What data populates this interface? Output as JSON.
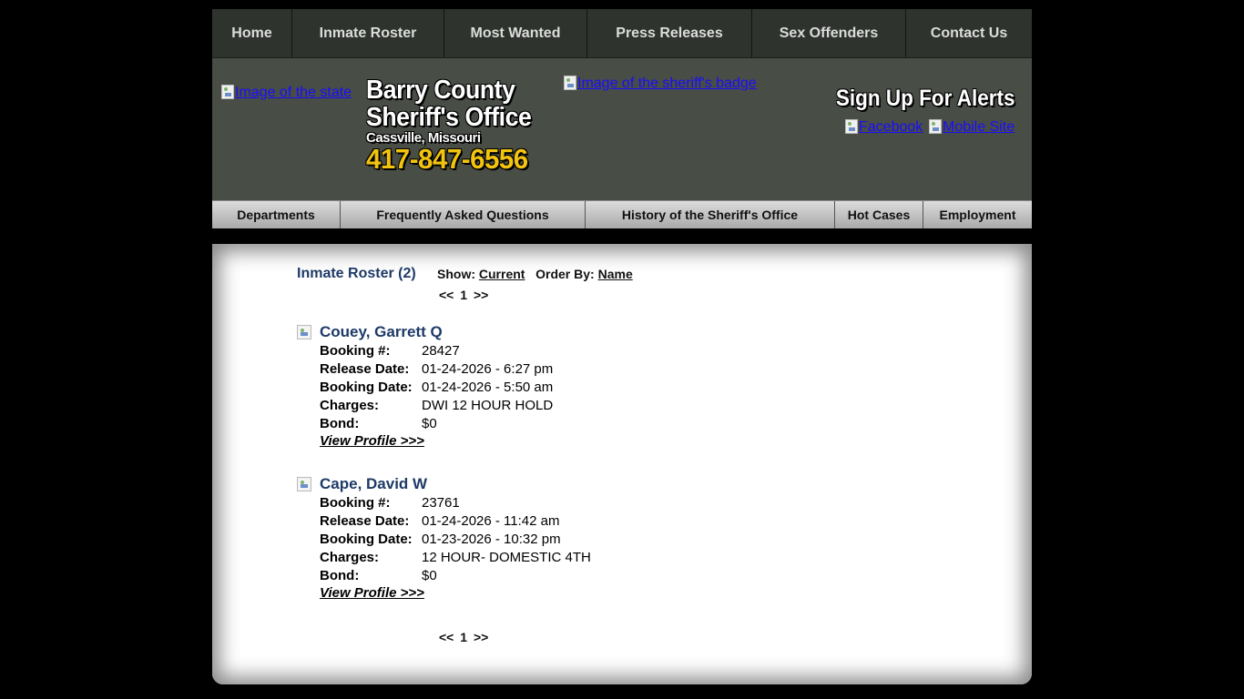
{
  "top_nav": [
    "Home",
    "Inmate Roster",
    "Most Wanted",
    "Press Releases",
    "Sex Offenders",
    "Contact Us"
  ],
  "header": {
    "state_image_alt": "Image of the state",
    "title_line1": "Barry County",
    "title_line2": "Sheriff's Office",
    "city": "Cassville, Missouri",
    "phone": "417-847-6556",
    "badge_image_alt": "Image of the sheriff's badge",
    "alerts": "Sign Up For Alerts",
    "facebook_alt": "Facebook",
    "mobile_alt": "Mobile Site"
  },
  "sub_nav": [
    "Departments",
    "Frequently Asked Questions",
    "History of the Sheriff's Office",
    "Hot Cases",
    "Employment"
  ],
  "content": {
    "title": "Inmate Roster (2)",
    "show_label": "Show:",
    "show_value": "Current",
    "order_label": "Order By:",
    "order_value": "Name",
    "pager": {
      "prev": "<<",
      "page": "1",
      "next": ">>"
    },
    "labels": {
      "booking": "Booking #:",
      "release": "Release Date:",
      "booking_date": "Booking Date:",
      "charges": "Charges:",
      "bond": "Bond:"
    },
    "view_profile": "View Profile >>>",
    "inmates": [
      {
        "name": "Couey, Garrett Q",
        "booking": "28427",
        "release": "01-24-2026 - 6:27 pm",
        "booking_date": "01-24-2026 - 5:50 am",
        "charges": "DWI 12 HOUR HOLD",
        "bond": "$0"
      },
      {
        "name": "Cape, David W",
        "booking": "23761",
        "release": "01-24-2026 - 11:42 am",
        "booking_date": "01-23-2026 - 10:32 pm",
        "charges": "12 HOUR- DOMESTIC 4TH",
        "bond": "$0"
      }
    ]
  }
}
